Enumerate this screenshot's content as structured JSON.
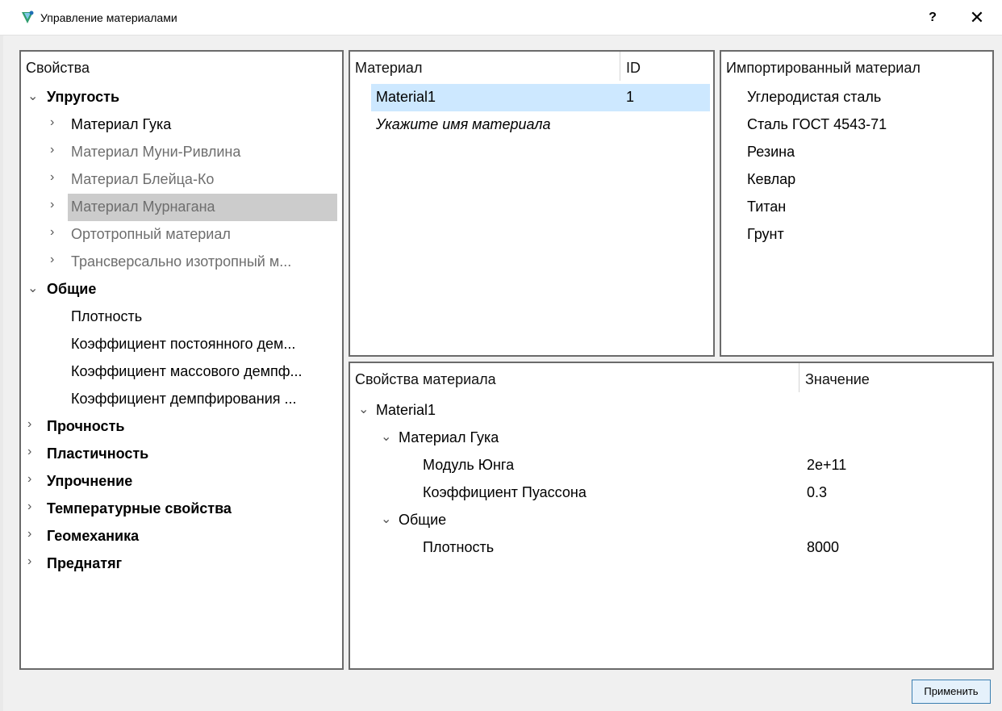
{
  "window": {
    "title": "Управление материалами",
    "help_label": "?",
    "close_label": "✕",
    "icon": "app-logo-icon"
  },
  "properties_panel": {
    "header": "Свойства",
    "tree": [
      {
        "label": "Упругость",
        "expanded": true,
        "level": 0,
        "bold": true
      },
      {
        "label": "Материал Гука",
        "level": 1,
        "enabled": true
      },
      {
        "label": "Материал Муни-Ривлина",
        "level": 1,
        "enabled": false
      },
      {
        "label": "Материал Блейца-Ко",
        "level": 1,
        "enabled": false
      },
      {
        "label": "Материал Мурнагана",
        "level": 1,
        "enabled": false,
        "selected": true
      },
      {
        "label": "Ортотропный материал",
        "level": 1,
        "enabled": false
      },
      {
        "label": "Трансверсально изотропный м...",
        "level": 1,
        "enabled": false
      },
      {
        "label": "Общие",
        "expanded": true,
        "level": 0,
        "bold": true
      },
      {
        "label": "Плотность",
        "level": 1
      },
      {
        "label": "Коэффициент постоянного дем...",
        "level": 1
      },
      {
        "label": "Коэффициент массового демпф...",
        "level": 1
      },
      {
        "label": "Коэффициент демпфирования ...",
        "level": 1
      },
      {
        "label": "Прочность",
        "level": 0,
        "bold": true
      },
      {
        "label": "Пластичность",
        "level": 0,
        "bold": true
      },
      {
        "label": "Упрочнение",
        "level": 0,
        "bold": true
      },
      {
        "label": "Температурные свойства",
        "level": 0,
        "bold": true
      },
      {
        "label": "Геомеханика",
        "level": 0,
        "bold": true
      },
      {
        "label": "Преднатяг",
        "level": 0,
        "bold": true
      }
    ]
  },
  "materials_table": {
    "col_material": "Материал",
    "col_id": "ID",
    "rows": [
      {
        "name": "Material1",
        "id": "1",
        "selected": true
      }
    ],
    "new_placeholder": "Укажите имя материала"
  },
  "imported_panel": {
    "header": "Импортированный материал",
    "items": [
      "Углеродистая сталь",
      "Сталь ГОСТ 4543-71",
      "Резина",
      "Кевлар",
      "Титан",
      "Грунт"
    ]
  },
  "material_props": {
    "col_property": "Свойства материала",
    "col_value": "Значение",
    "material": "Material1",
    "groups": [
      {
        "label": "Материал Гука",
        "props": [
          {
            "name": "Модуль Юнга",
            "value": "2e+11"
          },
          {
            "name": "Коэффициент Пуассона",
            "value": "0.3"
          }
        ]
      },
      {
        "label": "Общие",
        "props": [
          {
            "name": "Плотность",
            "value": "8000"
          }
        ]
      }
    ]
  },
  "footer": {
    "apply_label": "Применить"
  },
  "colors": {
    "selection_blue": "#cde8ff",
    "selection_gray": "#cccccc",
    "panel_border": "#6a6a6a",
    "disabled_text": "#6e6e6e"
  }
}
